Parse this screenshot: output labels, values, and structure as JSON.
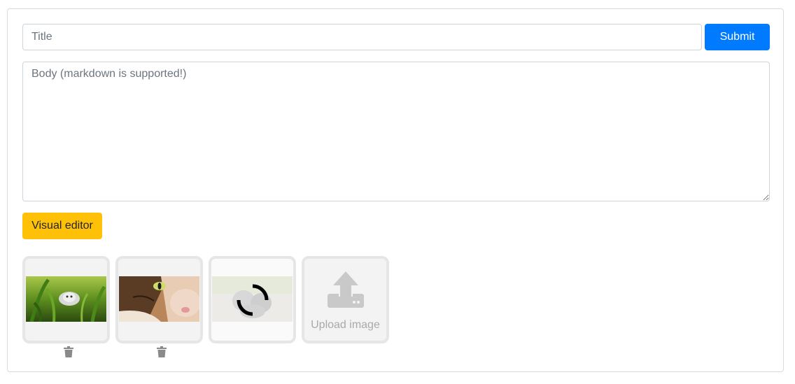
{
  "form": {
    "title_placeholder": "Title",
    "submit_label": "Submit",
    "body_placeholder": "Body (markdown is supported!)",
    "visual_editor_label": "Visual editor"
  },
  "images": {
    "items": [
      {
        "name": "cat-in-grass",
        "state": "uploaded"
      },
      {
        "name": "cat-face-closeup",
        "state": "uploaded"
      },
      {
        "name": "kittens",
        "state": "uploading"
      }
    ],
    "upload_label": "Upload image"
  },
  "colors": {
    "primary": "#007bff",
    "warning": "#ffc107",
    "border": "#ced4da",
    "thumb_border": "#e6e6e6",
    "muted": "#a9a9a9"
  },
  "icons": {
    "delete": "trash-icon",
    "upload": "upload-icon",
    "loading": "spinner-icon"
  }
}
